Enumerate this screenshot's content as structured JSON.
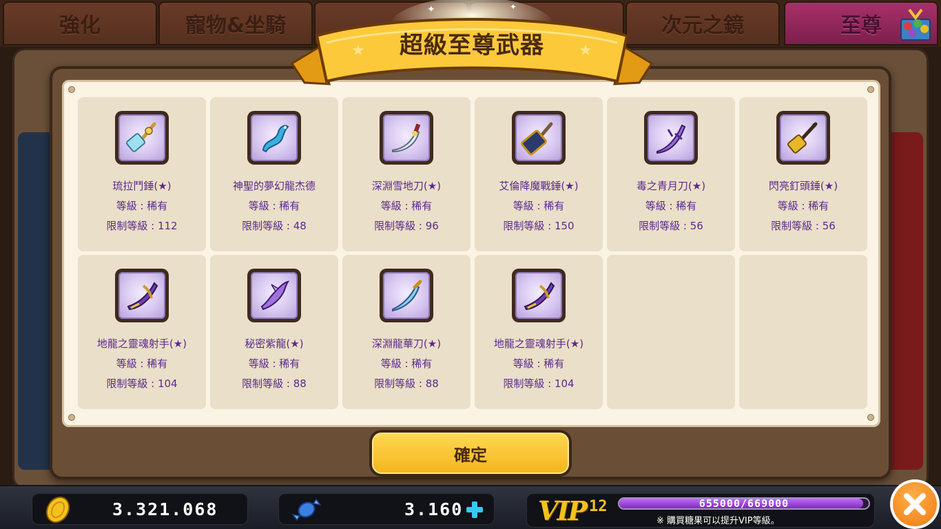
{
  "tabs": [
    "強化",
    "寵物&坐騎",
    "",
    "",
    "次元之鏡",
    "至尊"
  ],
  "banner": {
    "title": "超級至尊武器"
  },
  "items": [
    {
      "name": "琉拉鬥錘(★)",
      "grade": "等級 : 稀有",
      "level_req": "限制等級 : 112",
      "icon": "hammer-icon"
    },
    {
      "name": "神聖的夢幻龍杰德",
      "grade": "等級 : 稀有",
      "level_req": "限制等級 : 48",
      "icon": "blue-dragon-icon"
    },
    {
      "name": "深淵雪地刀(★)",
      "grade": "等級 : 稀有",
      "level_req": "限制等級 : 96",
      "icon": "blade-icon"
    },
    {
      "name": "艾倫降魔戰錘(★)",
      "grade": "等級 : 稀有",
      "level_req": "限制等級 : 150",
      "icon": "war-hammer-icon"
    },
    {
      "name": "毒之青月刀(★)",
      "grade": "等級 : 稀有",
      "level_req": "限制等級 : 56",
      "icon": "moon-blade-icon"
    },
    {
      "name": "閃亮釘頭錘(★)",
      "grade": "等級 : 稀有",
      "level_req": "限制等級 : 56",
      "icon": "mace-icon"
    },
    {
      "name": "地龍之靈魂射手(★)",
      "grade": "等級 : 稀有",
      "level_req": "限制等級 : 104",
      "icon": "crossbow-icon"
    },
    {
      "name": "秘密紫龍(★)",
      "grade": "等級 : 稀有",
      "level_req": "限制等級 : 88",
      "icon": "purple-dragon-icon"
    },
    {
      "name": "深淵龍華刀(★)",
      "grade": "等級 : 稀有",
      "level_req": "限制等級 : 88",
      "icon": "dragon-blade-icon"
    },
    {
      "name": "地龍之靈魂射手(★)",
      "grade": "等級 : 稀有",
      "level_req": "限制等級 : 104",
      "icon": "crossbow-icon"
    }
  ],
  "confirm_label": "確定",
  "currency": {
    "gold": "3.321.068",
    "candy": "3.160"
  },
  "vip": {
    "label": "VIP",
    "level": "12",
    "progress_text": "655000/669000",
    "progress_fraction": 0.979,
    "note": "※ 購買糖果可以提升VIP等級。"
  },
  "colors": {
    "item_text": "#5b2a8c",
    "gold_button": "#f4b51e",
    "vip_bar": "#b24cf0",
    "close_button": "#f07a10"
  }
}
